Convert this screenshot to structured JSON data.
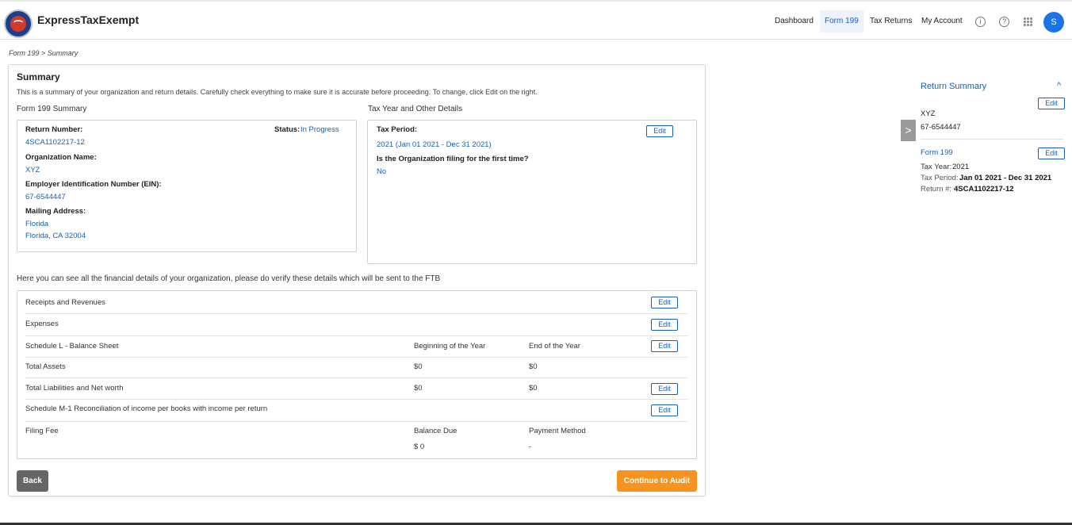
{
  "header": {
    "brand": "ExpressTaxExempt",
    "nav": [
      "Dashboard",
      "Form 199",
      "Tax Returns",
      "My Account"
    ],
    "avatar_initial": "S",
    "info_icon_glyph": "i",
    "help_icon_glyph": "?"
  },
  "breadcrumb": "Form 199 >  Summary",
  "summary": {
    "title": "Summary",
    "description": "This is a summary of your organization and return details. Carefully check everything to make sure it is accurate before proceeding. To change, click Edit on the right.",
    "form_section_title": "Form 199 Summary",
    "tax_section_title": "Tax Year and Other Details",
    "return_number_label": "Return Number:",
    "return_number": "4SCA1102217-12",
    "status_label": "Status:",
    "status_value": "In Progress",
    "org_name_label": "Organization Name:",
    "org_name": "XYZ",
    "ein_label": "Employer Identification Number (EIN):",
    "ein": "67-6544447",
    "mailing_label": "Mailing Address:",
    "address_line1": "Florida",
    "address_line2": "Florida, CA 32004",
    "tax_period_label": "Tax Period:",
    "tax_period": "2021 (Jan 01 2021 - Dec 31 2021)",
    "first_time_label": "Is the Organization filing for the first time?",
    "first_time": "No",
    "edit_label": "Edit"
  },
  "financial": {
    "intro": "Here you can see all the financial details of your organization, please do verify these details which will be sent to the FTB",
    "receipts": "Receipts and Revenues",
    "expenses": "Expenses",
    "schedule_l": "Schedule L - Balance Sheet",
    "col_beginning": "Beginning of the Year",
    "col_end": "End of the Year",
    "total_assets": "Total Assets",
    "total_assets_begin": "$0",
    "total_assets_end": "$0",
    "total_liabilities": "Total Liabilities and Net worth",
    "total_liabilities_begin": "$0",
    "total_liabilities_end": "$0",
    "schedule_m1": "Schedule M-1 Reconciliation of income per books with income per return",
    "filing_fee": "Filing Fee",
    "balance_due_label": "Balance Due",
    "payment_method_label": "Payment Method",
    "balance_due": "$ 0",
    "payment_method": "-"
  },
  "buttons": {
    "back": "Back",
    "continue": "Continue to Audit"
  },
  "sidebar": {
    "title": "Return Summary",
    "org_name": "XYZ",
    "ein": "67-6544447",
    "form_link": "Form 199",
    "tax_year_label": "Tax Year:",
    "tax_year": "2021",
    "tax_period_label": "Tax Period:",
    "tax_period": "Jan 01 2021 - Dec 31 2021",
    "return_label": "Return #:",
    "return_number": "4SCA1102217-12",
    "edit_label": "Edit",
    "collapse_glyph": "^",
    "toggle_glyph": ">"
  },
  "colors": {
    "accent": "#1a5fb4",
    "primary_button": "#f7931e",
    "secondary_button": "#666666"
  }
}
